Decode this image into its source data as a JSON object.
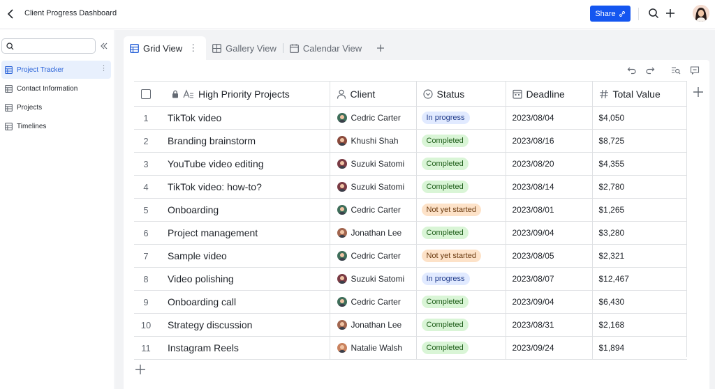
{
  "header": {
    "title": "Client Progress Dashboard",
    "share_label": "Share"
  },
  "sidebar": {
    "search_placeholder": "",
    "items": [
      {
        "label": "Project Tracker",
        "active": true
      },
      {
        "label": "Contact Information",
        "active": false
      },
      {
        "label": "Projects",
        "active": false
      },
      {
        "label": "Timelines",
        "active": false
      }
    ]
  },
  "tabs": [
    {
      "label": "Grid View",
      "icon": "grid-icon",
      "active": true
    },
    {
      "label": "Gallery View",
      "icon": "gallery-icon",
      "active": false
    },
    {
      "label": "Calendar View",
      "icon": "calendar-icon",
      "active": false
    }
  ],
  "table": {
    "columns": [
      "High Priority Projects",
      "Client",
      "Status",
      "Deadline",
      "Total Value"
    ],
    "rows": [
      {
        "num": "1",
        "project": "TikTok video",
        "client": "Cedric Carter",
        "status": "In progress",
        "deadline": "2023/08/04",
        "value": "$4,050"
      },
      {
        "num": "2",
        "project": "Branding brainstorm",
        "client": "Khushi Shah",
        "status": "Completed",
        "deadline": "2023/08/16",
        "value": "$8,725"
      },
      {
        "num": "3",
        "project": "YouTube video editing",
        "client": "Suzuki Satomi",
        "status": "Completed",
        "deadline": "2023/08/20",
        "value": "$4,355"
      },
      {
        "num": "4",
        "project": "TikTok video: how-to?",
        "client": "Suzuki Satomi",
        "status": "Completed",
        "deadline": "2023/08/14",
        "value": "$2,780"
      },
      {
        "num": "5",
        "project": "Onboarding",
        "client": "Cedric Carter",
        "status": "Not yet started",
        "deadline": "2023/08/01",
        "value": "$1,265"
      },
      {
        "num": "6",
        "project": "Project management",
        "client": "Jonathan Lee",
        "status": "Completed",
        "deadline": "2023/09/04",
        "value": "$3,280"
      },
      {
        "num": "7",
        "project": "Sample video",
        "client": "Cedric Carter",
        "status": "Not yet started",
        "deadline": "2023/08/05",
        "value": "$2,321"
      },
      {
        "num": "8",
        "project": "Video polishing",
        "client": "Suzuki Satomi",
        "status": "In progress",
        "deadline": "2023/08/07",
        "value": "$12,467"
      },
      {
        "num": "9",
        "project": "Onboarding call",
        "client": "Cedric Carter",
        "status": "Completed",
        "deadline": "2023/09/04",
        "value": "$6,430"
      },
      {
        "num": "10",
        "project": "Strategy discussion",
        "client": "Jonathan Lee",
        "status": "Completed",
        "deadline": "2023/08/31",
        "value": "$2,168"
      },
      {
        "num": "11",
        "project": "Instagram Reels",
        "client": "Natalie Walsh",
        "status": "Completed",
        "deadline": "2023/09/24",
        "value": "$1,894"
      }
    ]
  },
  "status_styles": {
    "In progress": "s-prog",
    "Completed": "s-done",
    "Not yet started": "s-todo"
  },
  "avatar_colors": {
    "Cedric Carter": "#3f6e5a",
    "Khushi Shah": "#8a4a3c",
    "Suzuki Satomi": "#7a3b44",
    "Jonathan Lee": "#a2664f",
    "Natalie Walsh": "#c9825e"
  },
  "colors": {
    "accent": "#1456f0",
    "sidebar_active_bg": "#e8f0fd",
    "sidebar_active_text": "#2a63d8"
  }
}
